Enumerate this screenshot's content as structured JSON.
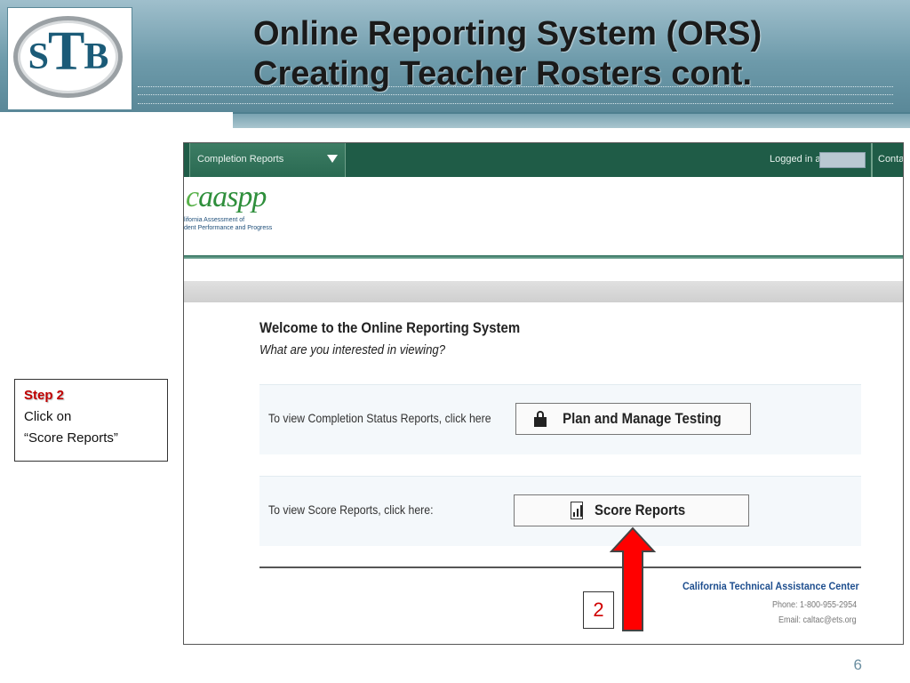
{
  "slide": {
    "title_line1": "Online Reporting System (ORS)",
    "title_line2": "Creating Teacher Rosters  cont.",
    "logo_text": {
      "s": "S",
      "t": "T",
      "b": "B"
    },
    "page_number": "6"
  },
  "step": {
    "title": "Step 2",
    "line1": "Click on",
    "line2": "“Score Reports”"
  },
  "ors": {
    "dropdown_label": "Completion Reports",
    "logged_in_label": "Logged in as:",
    "contact_label": "Contac",
    "logo_mark": "aaspp",
    "logo_mark_prefix": "c",
    "logo_sub_line1": "lifornia Assessment of",
    "logo_sub_line2": "dent Performance and Progress",
    "welcome": "Welcome to the Online Reporting System",
    "question": "What are you interested in viewing?",
    "row1_label": "To view Completion Status Reports, click here",
    "row1_button": "Plan and Manage Testing",
    "row2_label": "To view Score Reports, click here:",
    "row2_button": "Score Reports",
    "footer_org": "California Technical Assistance Center",
    "footer_phone": "Phone: 1-800-955-2954",
    "footer_email": "Email: caltac@ets.org"
  },
  "annotation": {
    "badge": "2",
    "arrow_color": "#ff0000"
  },
  "colors": {
    "header_teal": "#6d9aaa",
    "ors_green": "#1f5c47",
    "step_red": "#c00000"
  },
  "icons": [
    "lock-icon",
    "chart-icon",
    "dropdown-triangle-icon"
  ]
}
